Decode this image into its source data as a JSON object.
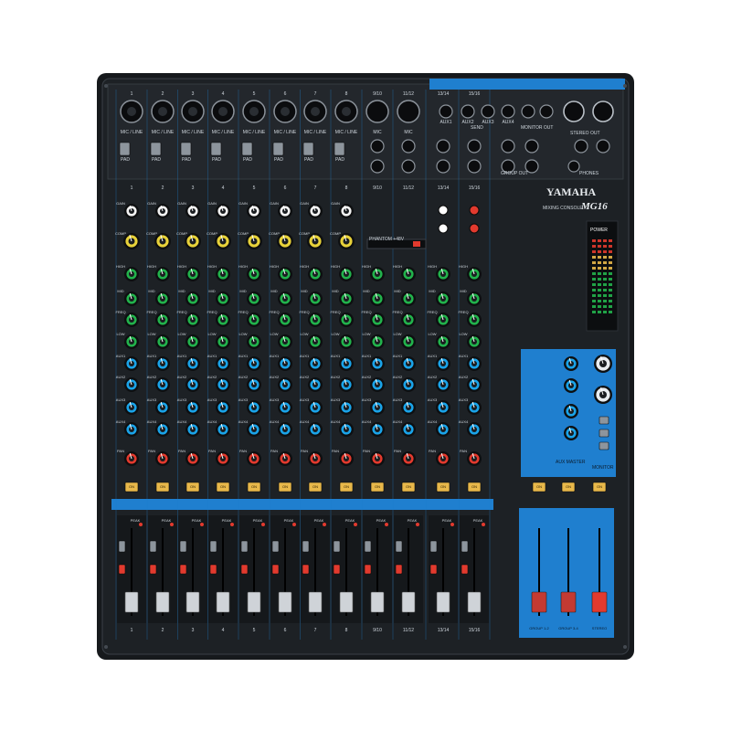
{
  "device": {
    "brand": "YAMAHA",
    "series": "MIXING CONSOLE",
    "model": "MG16"
  },
  "top_panel": {
    "mono_input_label": "MIC / LINE",
    "mono_channel_numbers": [
      "1",
      "2",
      "3",
      "4",
      "5",
      "6",
      "7",
      "8"
    ],
    "stereo_channel_numbers": [
      "9/10",
      "11/12",
      "13/14",
      "15/16"
    ],
    "pad_label": "PAD",
    "mic_label": "MIC",
    "send_labels": [
      "AUX1",
      "AUX2",
      "AUX3",
      "AUX4"
    ],
    "send_section_label": "SEND",
    "monitor_out_label": "MONITOR OUT",
    "stereo_out_label": "STEREO OUT",
    "group_out_label": "GROUP OUT",
    "phones_label": "PHONES",
    "phantom_label": "PHANTOM +48V"
  },
  "channel_strip": {
    "knob_rows": [
      {
        "label": "GAIN",
        "color": "#f2f2f2"
      },
      {
        "label": "COMP",
        "color": "#e8d23a"
      },
      {
        "label": "HIGH",
        "color": "#22b24c"
      },
      {
        "label": "MID",
        "color": "#22b24c"
      },
      {
        "label": "FREQ",
        "color": "#22b24c"
      },
      {
        "label": "LOW",
        "color": "#22b24c"
      },
      {
        "label": "AUX1",
        "color": "#1aa3e8"
      },
      {
        "label": "AUX2",
        "color": "#1aa3e8"
      },
      {
        "label": "AUX3",
        "color": "#1aa3e8"
      },
      {
        "label": "AUX4",
        "color": "#1aa3e8"
      },
      {
        "label": "PAN",
        "color": "#e23a2e"
      }
    ],
    "on_label": "ON",
    "peak_label": "PEAK",
    "pfl_label": "PFL"
  },
  "master": {
    "power_label": "POWER",
    "aux_master_label": "AUX MASTER",
    "monitor_label": "MONITOR",
    "group_label": "GROUP",
    "stereo_label": "STEREO",
    "fader_labels": [
      "GROUP 1-2",
      "GROUP 3-4",
      "STEREO"
    ]
  },
  "colors": {
    "body": "#1c1f23",
    "accent_blue": "#1f7fcf",
    "on_button": "#e8b84a",
    "knob_green": "#22b24c",
    "knob_blue": "#1aa3e8",
    "knob_red": "#e23a2e",
    "knob_yellow": "#e8d23a"
  }
}
